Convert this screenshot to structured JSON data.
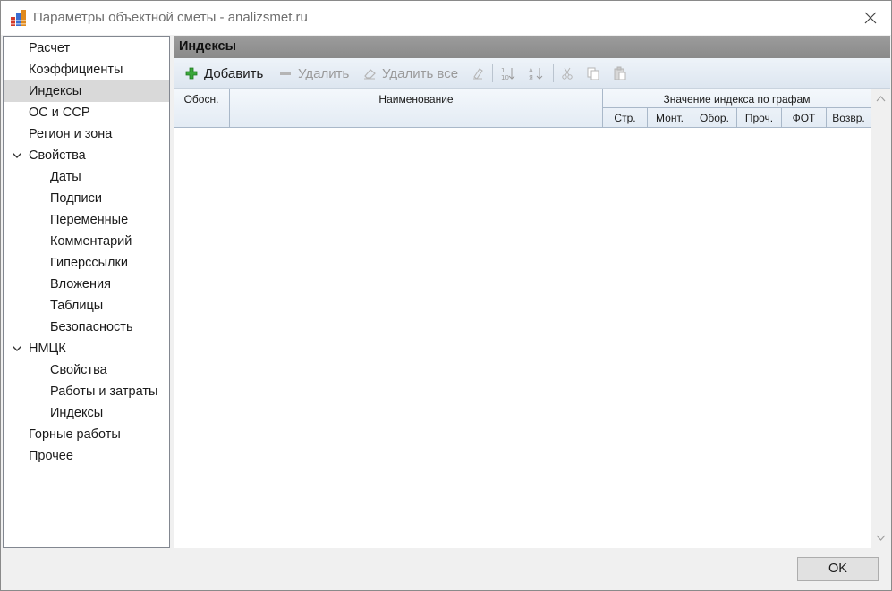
{
  "window": {
    "title": "Параметры объектной сметы - analizsmet.ru"
  },
  "sidebar": {
    "items": [
      {
        "label": "Расчет",
        "level": 0,
        "expandable": false,
        "selected": false
      },
      {
        "label": "Коэффициенты",
        "level": 0,
        "expandable": false,
        "selected": false
      },
      {
        "label": "Индексы",
        "level": 0,
        "expandable": false,
        "selected": true
      },
      {
        "label": "ОС и ССР",
        "level": 0,
        "expandable": false,
        "selected": false
      },
      {
        "label": "Регион и зона",
        "level": 0,
        "expandable": false,
        "selected": false
      },
      {
        "label": "Свойства",
        "level": 0,
        "expandable": true,
        "selected": false
      },
      {
        "label": "Даты",
        "level": 1,
        "expandable": false,
        "selected": false
      },
      {
        "label": "Подписи",
        "level": 1,
        "expandable": false,
        "selected": false
      },
      {
        "label": "Переменные",
        "level": 1,
        "expandable": false,
        "selected": false
      },
      {
        "label": "Комментарий",
        "level": 1,
        "expandable": false,
        "selected": false
      },
      {
        "label": "Гиперссылки",
        "level": 1,
        "expandable": false,
        "selected": false
      },
      {
        "label": "Вложения",
        "level": 1,
        "expandable": false,
        "selected": false
      },
      {
        "label": "Таблицы",
        "level": 1,
        "expandable": false,
        "selected": false
      },
      {
        "label": "Безопасность",
        "level": 1,
        "expandable": false,
        "selected": false
      },
      {
        "label": "НМЦК",
        "level": 0,
        "expandable": true,
        "selected": false
      },
      {
        "label": "Свойства",
        "level": 1,
        "expandable": false,
        "selected": false
      },
      {
        "label": "Работы и затраты",
        "level": 1,
        "expandable": false,
        "selected": false
      },
      {
        "label": "Индексы",
        "level": 1,
        "expandable": false,
        "selected": false
      },
      {
        "label": "Горные работы",
        "level": 0,
        "expandable": false,
        "selected": false
      },
      {
        "label": "Прочее",
        "level": 0,
        "expandable": false,
        "selected": false
      }
    ]
  },
  "panel": {
    "title": "Индексы"
  },
  "toolbar": {
    "add_label": "Добавить",
    "delete_label": "Удалить",
    "delete_all_label": "Удалить все"
  },
  "grid": {
    "col_basis": "Обосн.",
    "col_name": "Наименование",
    "group_header": "Значение индекса по графам",
    "sub_columns": [
      "Стр.",
      "Монт.",
      "Обор.",
      "Проч.",
      "ФОТ",
      "Возвр."
    ],
    "rows": []
  },
  "footer": {
    "ok_label": "OK"
  },
  "colors": {
    "accent_green": "#2e9e2e",
    "selection": "#d9d9d9",
    "panel_header": "#8f8f8f"
  }
}
